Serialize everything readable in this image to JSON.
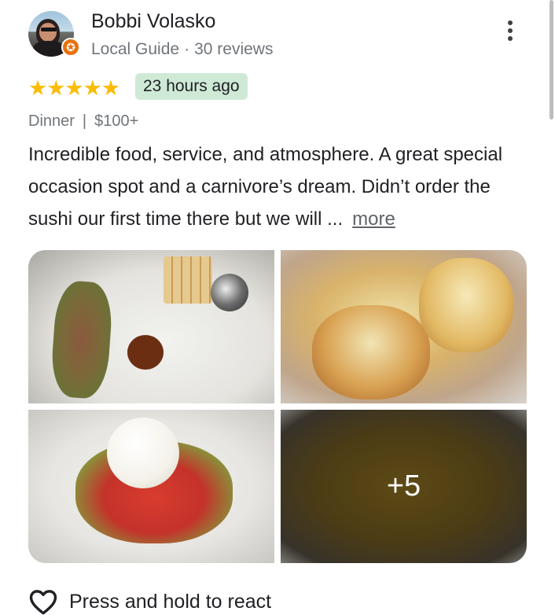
{
  "reviewer": {
    "name": "Bobbi Volasko",
    "badge": "Local Guide",
    "separator": "·",
    "reviews_count": "30 reviews"
  },
  "rating": {
    "stars": 5,
    "stars_text": "★★★★★",
    "time_ago": "23 hours ago"
  },
  "meta": {
    "meal_type": "Dinner",
    "separator": "|",
    "price": "$100+"
  },
  "review": {
    "text": "Incredible food, service, and atmosphere. A great special occasion spot and a carnivore’s dream. Didn’t order the sushi our first time there but we will ...",
    "more_label": "more"
  },
  "photos": {
    "extra_count_label": "+5"
  },
  "react": {
    "label": "Press and hold to react",
    "icon": "heart-outline-icon"
  },
  "colors": {
    "star": "#fbbc04",
    "time_chip_bg": "#ceead6",
    "local_guide_badge": "#e8710a",
    "secondary_text": "#70757a"
  }
}
